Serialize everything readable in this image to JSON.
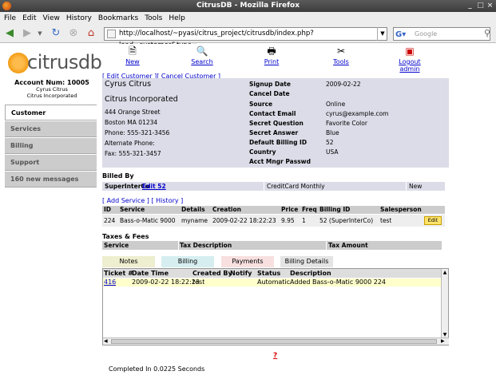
{
  "window": {
    "title": "CitrusDB - Mozilla Firefox"
  },
  "menu": [
    "File",
    "Edit",
    "View",
    "History",
    "Bookmarks",
    "Tools",
    "Help"
  ],
  "nav": {
    "url": "http://localhost/~pyasi/citrus_project/citrusdb/index.php?load=customer&type=",
    "search_placeholder": "Google"
  },
  "logo": {
    "text": "citrusdb"
  },
  "account": {
    "num_label": "Account Num: 10005",
    "line1": "Cyrus Citrus",
    "line2": "Citrus Incorporated"
  },
  "sidebar": [
    {
      "label": "Customer",
      "active": true
    },
    {
      "label": "Services"
    },
    {
      "label": "Billing"
    },
    {
      "label": "Support"
    },
    {
      "label": "160 new messages"
    }
  ],
  "toolbar": [
    {
      "label": "New",
      "icon": "new-icon"
    },
    {
      "label": "Search",
      "icon": "search-icon"
    },
    {
      "label": "Print",
      "icon": "print-icon"
    },
    {
      "label": "Tools",
      "icon": "tools-icon"
    },
    {
      "label": "Logout admin",
      "icon": "logout-icon"
    }
  ],
  "edit_links": "[ Edit Customer ][ Cancel Customer ]",
  "customer": {
    "name": "Cyrus Citrus",
    "company": "Citrus Incorporated",
    "street": "444 Orange Street",
    "city": "Boston MA 01234",
    "phone": "Phone: 555-321-3456",
    "alt_phone": "Alternate Phone:",
    "fax": "Fax: 555-321-3457"
  },
  "details": [
    {
      "label": "Signup Date",
      "value": "2009-02-22"
    },
    {
      "label": "Cancel Date",
      "value": ""
    },
    {
      "label": "Source",
      "value": "Online"
    },
    {
      "label": "Contact Email",
      "value": "cyrus@example.com"
    },
    {
      "label": "Secret Question",
      "value": "Favorite Color"
    },
    {
      "label": "Secret Answer",
      "value": "Blue"
    },
    {
      "label": "Default Billing ID",
      "value": "52"
    },
    {
      "label": "Country",
      "value": "USA"
    },
    {
      "label": "Acct Mngr Passwd",
      "value": ""
    }
  ],
  "billed_by": {
    "title": "Billed By",
    "name": "SuperInterCo",
    "edit_link": "Edit 52",
    "method": "CreditCard Monthly",
    "status": "New"
  },
  "services_links": {
    "add": "[ Add Service ]",
    "history": "[ History ]"
  },
  "services": {
    "headers": [
      "ID",
      "Service",
      "Details",
      "Creation",
      "Price",
      "Freq",
      "Billing ID",
      "Salesperson"
    ],
    "rows": [
      [
        "224",
        "Bass-o-Matic 9000",
        "myname",
        "2009-02-22 18:22:23",
        "9.95",
        "1",
        "52 (SuperInterCo)",
        "test"
      ]
    ],
    "edit_label": "Edit"
  },
  "taxes": {
    "title": "Taxes & Fees",
    "headers": [
      "Service",
      "Tax Description",
      "Tax Amount"
    ]
  },
  "tabs": [
    {
      "label": "Notes",
      "color": "#eeeed0"
    },
    {
      "label": "Billing",
      "color": "#d6eef0"
    },
    {
      "label": "Payments",
      "color": "#f8e0e0"
    },
    {
      "label": "Billing Details",
      "color": "#e4e4e4"
    }
  ],
  "tickets": {
    "headers": [
      "Ticket #",
      "Date Time",
      "Created By",
      "Notify",
      "Status",
      "Description"
    ],
    "rows": [
      [
        "416",
        "2009-02-22 18:22:23",
        "test",
        "",
        "Automatic",
        "Added Bass-o-Matic 9000 224"
      ]
    ]
  },
  "help_link": "?",
  "footer": "Completed In 0.0225 Seconds"
}
